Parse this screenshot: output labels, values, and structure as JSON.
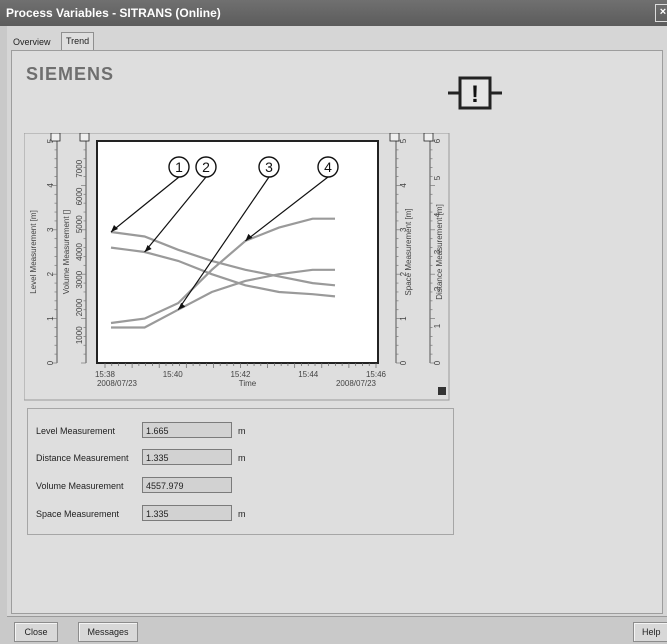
{
  "window": {
    "title": "Process Variables - SITRANS  (Online)"
  },
  "tabs": [
    {
      "label": "Overview",
      "selected": false
    },
    {
      "label": "Trend",
      "selected": true
    }
  ],
  "logo": {
    "text": "SIEMENS"
  },
  "status_icon": {
    "name": "maintenance-warning-icon",
    "glyph": "!"
  },
  "chart_data": {
    "type": "line",
    "xlabel": "Time",
    "x_ticks": [
      "15:38",
      "15:40",
      "15:42",
      "15:44",
      "15:46"
    ],
    "x_date_left": "2008/07/23",
    "x_date_right": "2008/07/23",
    "axes_left": [
      {
        "label": "Level Measurement [m]",
        "ticks": [
          "0",
          "1",
          "2",
          "3",
          "4",
          "5"
        ],
        "range": [
          0,
          5
        ]
      },
      {
        "label": "Volume Measurement []",
        "ticks": [
          "1000",
          "2000",
          "3000",
          "4000",
          "5000",
          "6000",
          "7000"
        ],
        "range": [
          0,
          8000
        ]
      }
    ],
    "axes_right": [
      {
        "label": "Space Measurement [m]",
        "ticks": [
          "0",
          "1",
          "2",
          "3",
          "4",
          "5"
        ],
        "range": [
          0,
          5
        ]
      },
      {
        "label": "Distance Measurement [m]",
        "ticks": [
          "0",
          "1",
          "2",
          "3",
          "4",
          "5",
          "6"
        ],
        "range": [
          0,
          6
        ]
      }
    ],
    "callouts": [
      "1",
      "2",
      "3",
      "4"
    ],
    "series": [
      {
        "x": [
          0,
          0.15,
          0.3,
          0.45,
          0.6,
          0.75,
          0.9,
          1.0
        ],
        "y": [
          2.95,
          2.85,
          2.55,
          2.3,
          2.1,
          1.95,
          1.8,
          1.75
        ],
        "color": "#9a9a9a"
      },
      {
        "x": [
          0,
          0.15,
          0.3,
          0.45,
          0.6,
          0.75,
          0.9,
          1.0
        ],
        "y": [
          2.6,
          2.5,
          2.3,
          2.0,
          1.75,
          1.6,
          1.55,
          1.5
        ],
        "color": "#9a9a9a"
      },
      {
        "x": [
          0,
          0.15,
          0.3,
          0.45,
          0.6,
          0.75,
          0.9,
          1.0
        ],
        "y": [
          0.8,
          0.8,
          1.2,
          1.6,
          1.85,
          2.0,
          2.1,
          2.1
        ],
        "color": "#9a9a9a"
      },
      {
        "x": [
          0,
          0.15,
          0.3,
          0.45,
          0.6,
          0.75,
          0.9,
          1.0
        ],
        "y": [
          0.9,
          1.0,
          1.35,
          2.1,
          2.75,
          3.05,
          3.25,
          3.25
        ],
        "color": "#9a9a9a"
      }
    ],
    "callout_targets": [
      0.0,
      0.15,
      0.3,
      0.6
    ]
  },
  "values": [
    {
      "label": "Level Measurement",
      "value": "1.665",
      "unit": "m"
    },
    {
      "label": "Distance Measurement",
      "value": "1.335",
      "unit": "m"
    },
    {
      "label": "Volume Measurement",
      "value": "4557.979",
      "unit": ""
    },
    {
      "label": "Space Measurement",
      "value": "1.335",
      "unit": "m"
    }
  ],
  "buttons": {
    "close": "Close",
    "messages": "Messages",
    "help": "Help"
  }
}
